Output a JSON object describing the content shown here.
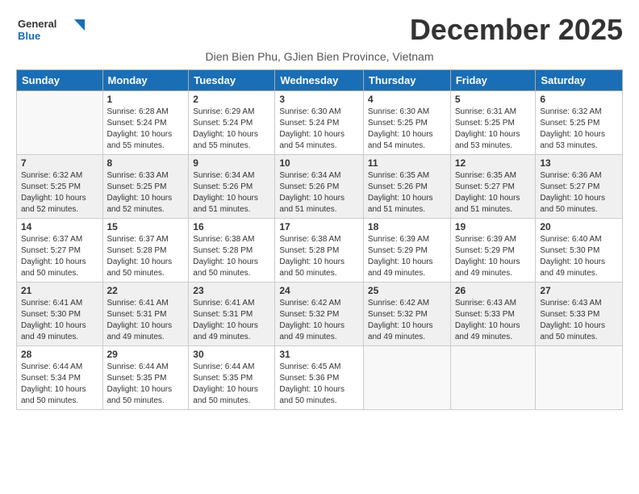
{
  "logo": {
    "line1": "General",
    "line2": "Blue"
  },
  "title": "December 2025",
  "subtitle": "Dien Bien Phu, GJien Bien Province, Vietnam",
  "header": {
    "days": [
      "Sunday",
      "Monday",
      "Tuesday",
      "Wednesday",
      "Thursday",
      "Friday",
      "Saturday"
    ]
  },
  "weeks": [
    {
      "cells": [
        {
          "day": "",
          "info": ""
        },
        {
          "day": "1",
          "info": "Sunrise: 6:28 AM\nSunset: 5:24 PM\nDaylight: 10 hours\nand 55 minutes."
        },
        {
          "day": "2",
          "info": "Sunrise: 6:29 AM\nSunset: 5:24 PM\nDaylight: 10 hours\nand 55 minutes."
        },
        {
          "day": "3",
          "info": "Sunrise: 6:30 AM\nSunset: 5:24 PM\nDaylight: 10 hours\nand 54 minutes."
        },
        {
          "day": "4",
          "info": "Sunrise: 6:30 AM\nSunset: 5:25 PM\nDaylight: 10 hours\nand 54 minutes."
        },
        {
          "day": "5",
          "info": "Sunrise: 6:31 AM\nSunset: 5:25 PM\nDaylight: 10 hours\nand 53 minutes."
        },
        {
          "day": "6",
          "info": "Sunrise: 6:32 AM\nSunset: 5:25 PM\nDaylight: 10 hours\nand 53 minutes."
        }
      ]
    },
    {
      "cells": [
        {
          "day": "7",
          "info": "Sunrise: 6:32 AM\nSunset: 5:25 PM\nDaylight: 10 hours\nand 52 minutes."
        },
        {
          "day": "8",
          "info": "Sunrise: 6:33 AM\nSunset: 5:25 PM\nDaylight: 10 hours\nand 52 minutes."
        },
        {
          "day": "9",
          "info": "Sunrise: 6:34 AM\nSunset: 5:26 PM\nDaylight: 10 hours\nand 51 minutes."
        },
        {
          "day": "10",
          "info": "Sunrise: 6:34 AM\nSunset: 5:26 PM\nDaylight: 10 hours\nand 51 minutes."
        },
        {
          "day": "11",
          "info": "Sunrise: 6:35 AM\nSunset: 5:26 PM\nDaylight: 10 hours\nand 51 minutes."
        },
        {
          "day": "12",
          "info": "Sunrise: 6:35 AM\nSunset: 5:27 PM\nDaylight: 10 hours\nand 51 minutes."
        },
        {
          "day": "13",
          "info": "Sunrise: 6:36 AM\nSunset: 5:27 PM\nDaylight: 10 hours\nand 50 minutes."
        }
      ]
    },
    {
      "cells": [
        {
          "day": "14",
          "info": "Sunrise: 6:37 AM\nSunset: 5:27 PM\nDaylight: 10 hours\nand 50 minutes."
        },
        {
          "day": "15",
          "info": "Sunrise: 6:37 AM\nSunset: 5:28 PM\nDaylight: 10 hours\nand 50 minutes."
        },
        {
          "day": "16",
          "info": "Sunrise: 6:38 AM\nSunset: 5:28 PM\nDaylight: 10 hours\nand 50 minutes."
        },
        {
          "day": "17",
          "info": "Sunrise: 6:38 AM\nSunset: 5:28 PM\nDaylight: 10 hours\nand 50 minutes."
        },
        {
          "day": "18",
          "info": "Sunrise: 6:39 AM\nSunset: 5:29 PM\nDaylight: 10 hours\nand 49 minutes."
        },
        {
          "day": "19",
          "info": "Sunrise: 6:39 AM\nSunset: 5:29 PM\nDaylight: 10 hours\nand 49 minutes."
        },
        {
          "day": "20",
          "info": "Sunrise: 6:40 AM\nSunset: 5:30 PM\nDaylight: 10 hours\nand 49 minutes."
        }
      ]
    },
    {
      "cells": [
        {
          "day": "21",
          "info": "Sunrise: 6:41 AM\nSunset: 5:30 PM\nDaylight: 10 hours\nand 49 minutes."
        },
        {
          "day": "22",
          "info": "Sunrise: 6:41 AM\nSunset: 5:31 PM\nDaylight: 10 hours\nand 49 minutes."
        },
        {
          "day": "23",
          "info": "Sunrise: 6:41 AM\nSunset: 5:31 PM\nDaylight: 10 hours\nand 49 minutes."
        },
        {
          "day": "24",
          "info": "Sunrise: 6:42 AM\nSunset: 5:32 PM\nDaylight: 10 hours\nand 49 minutes."
        },
        {
          "day": "25",
          "info": "Sunrise: 6:42 AM\nSunset: 5:32 PM\nDaylight: 10 hours\nand 49 minutes."
        },
        {
          "day": "26",
          "info": "Sunrise: 6:43 AM\nSunset: 5:33 PM\nDaylight: 10 hours\nand 49 minutes."
        },
        {
          "day": "27",
          "info": "Sunrise: 6:43 AM\nSunset: 5:33 PM\nDaylight: 10 hours\nand 50 minutes."
        }
      ]
    },
    {
      "cells": [
        {
          "day": "28",
          "info": "Sunrise: 6:44 AM\nSunset: 5:34 PM\nDaylight: 10 hours\nand 50 minutes."
        },
        {
          "day": "29",
          "info": "Sunrise: 6:44 AM\nSunset: 5:35 PM\nDaylight: 10 hours\nand 50 minutes."
        },
        {
          "day": "30",
          "info": "Sunrise: 6:44 AM\nSunset: 5:35 PM\nDaylight: 10 hours\nand 50 minutes."
        },
        {
          "day": "31",
          "info": "Sunrise: 6:45 AM\nSunset: 5:36 PM\nDaylight: 10 hours\nand 50 minutes."
        },
        {
          "day": "",
          "info": ""
        },
        {
          "day": "",
          "info": ""
        },
        {
          "day": "",
          "info": ""
        }
      ]
    }
  ]
}
